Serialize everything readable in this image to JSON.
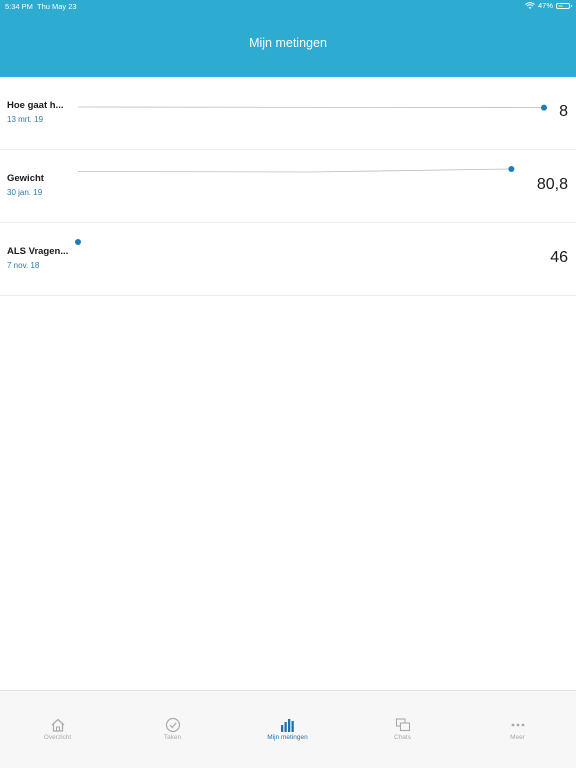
{
  "statusbar": {
    "time": "5:34 PM",
    "date": "Thu May 23",
    "battery": "47%",
    "battery_level": 0.47
  },
  "header": {
    "title": "Mijn metingen"
  },
  "measurements": [
    {
      "label": "Hoe gaat h...",
      "date": "13 mrt. 19",
      "value": "8",
      "spark_icon": "sparkline",
      "points": [
        [
          0.0,
          0.0
        ],
        [
          1.0,
          0.12
        ]
      ]
    },
    {
      "label": "Gewicht",
      "date": "30 jan. 19",
      "value": "80,8",
      "spark_icon": "sparkline",
      "points": [
        [
          0.0,
          0.5
        ],
        [
          0.5,
          0.6
        ],
        [
          0.93,
          0.0
        ]
      ]
    },
    {
      "label": "ALS Vragen...",
      "date": "7 nov. 18",
      "value": "46",
      "spark_icon": "sparkline",
      "points": [
        [
          0.0,
          0.0
        ]
      ]
    }
  ],
  "tabbar": {
    "tabs": [
      {
        "label": "Overzicht",
        "icon": "home-icon",
        "active": false
      },
      {
        "label": "Taken",
        "icon": "check-circle-icon",
        "active": false
      },
      {
        "label": "Mijn metingen",
        "icon": "bar-chart-icon",
        "active": true
      },
      {
        "label": "Chats",
        "icon": "chat-icon",
        "active": false
      },
      {
        "label": "Meer",
        "icon": "more-icon",
        "active": false
      }
    ]
  },
  "colors": {
    "header": "#2eabd0",
    "accent": "#1f73ad",
    "date_blue": "#2d7ab0",
    "dot": "#1e7fb8"
  }
}
